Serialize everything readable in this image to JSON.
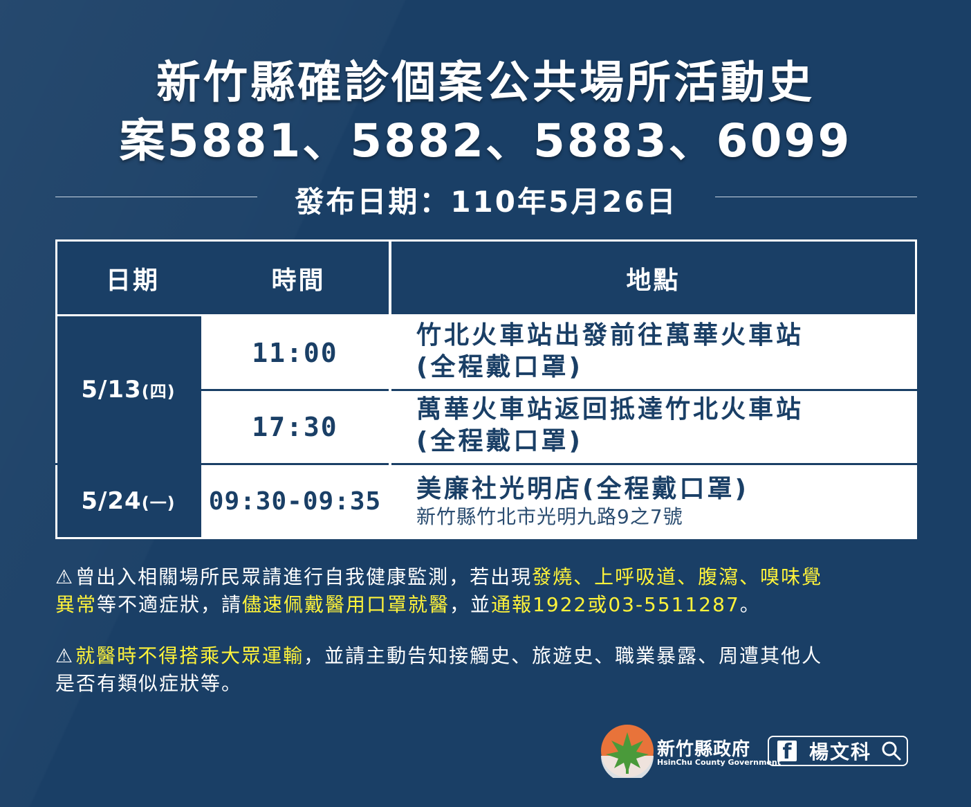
{
  "header": {
    "title_line1": "新竹縣確診個案公共場所活動史",
    "title_line2": "案5881、5882、5883、6099",
    "publish_date": "發布日期：110年5月26日"
  },
  "table": {
    "columns": [
      "日期",
      "時間",
      "地點"
    ],
    "groups": [
      {
        "date": "5/13",
        "weekday": "(四)",
        "rows": [
          {
            "time": "11:00",
            "place_line1": "竹北火車站出發前往萬華火車站",
            "place_line2": "(全程戴口罩)"
          },
          {
            "time": "17:30",
            "place_line1": "萬華火車站返回抵達竹北火車站",
            "place_line2": "(全程戴口罩)"
          }
        ]
      },
      {
        "date": "5/24",
        "weekday": "(一)",
        "rows": [
          {
            "time": "09:30-09:35",
            "place_line1": "美廉社光明店(全程戴口罩)",
            "address": "新竹縣竹北市光明九路9之7號"
          }
        ]
      }
    ]
  },
  "notes": {
    "note1": {
      "icon": "warning-icon",
      "text1": "曾出入相關場所民眾請進行自我健康監測，若出現",
      "hl1": "發燒、上呼吸道、腹瀉、嗅味覺",
      "hl2": "異常",
      "text2": "等不適症狀，請",
      "hl3": "儘速佩戴醫用口罩就醫",
      "text3": "，並",
      "hl4": "通報1922或03-5511287",
      "text4": "。"
    },
    "note2": {
      "icon": "warning-icon",
      "hl1": "就醫時不得搭乘大眾運輸",
      "text1": "，並請主動告知接觸史、旅遊史、職業暴露、周遭其他人",
      "text2": "是否有類似症狀等。"
    }
  },
  "footer": {
    "gov_name": "新竹縣政府",
    "gov_name_en": "HsinChu County Government",
    "facebook_icon": "facebook-icon",
    "facebook_name": "楊文科",
    "search_icon": "search-icon"
  },
  "colors": {
    "background": "#1a3f66",
    "highlight": "#fff33a",
    "table_white": "#ffffff"
  }
}
